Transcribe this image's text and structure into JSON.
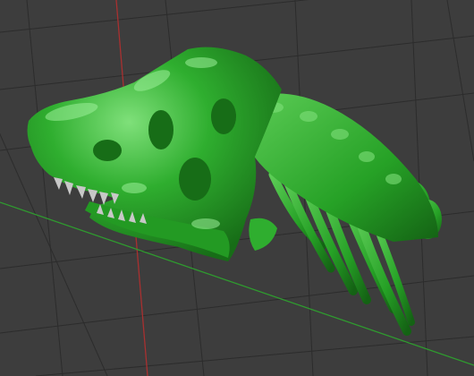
{
  "viewport": {
    "background_color": "#3d3d3d",
    "grid_color": "#2c2c2c",
    "x_axis_color": "#2f9a2f",
    "y_axis_color": "#a83030",
    "model_name": "t-rex-skull-with-neck-vertebrae",
    "model_color": "#2fae2f",
    "model_highlight_color": "#7fe07a",
    "model_shadow_color": "#176d17",
    "teeth_color": "#c8c8c8"
  }
}
